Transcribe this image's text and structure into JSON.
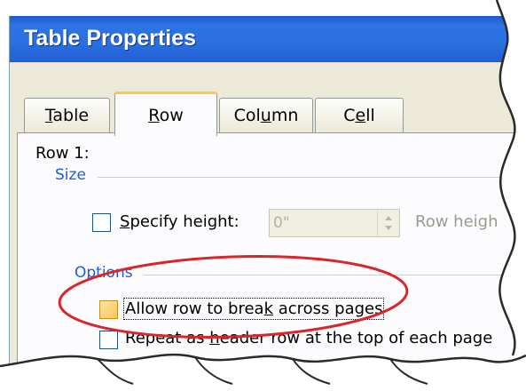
{
  "window": {
    "title": "Table Properties"
  },
  "tabs": [
    {
      "label": "Table",
      "mnemonic_index": 0,
      "active": false
    },
    {
      "label": "Row",
      "mnemonic_index": 0,
      "active": true
    },
    {
      "label": "Column",
      "mnemonic_index": 3,
      "active": false
    },
    {
      "label": "Cell",
      "mnemonic_index": 1,
      "active": false
    }
  ],
  "row_panel": {
    "row_label": "Row 1:",
    "size_group": {
      "title": "Size",
      "specify_height": {
        "label": "Specify height:",
        "mnemonic_index": 0,
        "checked": false
      },
      "height_input": {
        "value": "0\"",
        "enabled": false
      },
      "row_height_is_label": "Row heigh"
    },
    "options_group": {
      "title": "Options",
      "allow_break": {
        "label": "Allow row to break across pages",
        "mnemonic_char": "k",
        "checked": false
      },
      "repeat_header": {
        "label": "Repeat as header row at the top of each page",
        "mnemonic_char": "h",
        "checked": false
      }
    }
  },
  "annotation": {
    "color": "#d9262b",
    "shape": "ellipse"
  },
  "colors": {
    "titlebar": "#2b6fe0",
    "dialog_bg": "#ece9d8",
    "group_title": "#1d5cd8",
    "active_tab_accent": "#ffc83c"
  }
}
